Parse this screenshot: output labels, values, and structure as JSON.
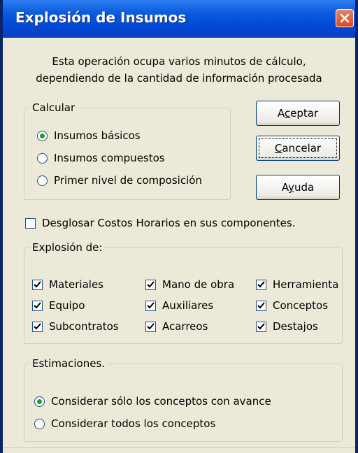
{
  "window": {
    "title": "Explosión de Insumos"
  },
  "intro": {
    "line1": "Esta operación ocupa varios minutos de cálculo,",
    "line2": "dependiendo de la cantidad de información procesada"
  },
  "calcular": {
    "label": "Calcular",
    "options": [
      {
        "label": "Insumos básicos",
        "checked": true
      },
      {
        "label": "Insumos compuestos",
        "checked": false
      },
      {
        "label": "Primer nivel de composición",
        "checked": false
      }
    ]
  },
  "buttons": {
    "aceptar_pre": "A",
    "aceptar_u": "c",
    "aceptar_post": "eptar",
    "cancelar_u": "C",
    "cancelar_post": "ancelar",
    "ayuda_pre": "A",
    "ayuda_u": "y",
    "ayuda_post": "uda"
  },
  "desglosar": {
    "label": "Desglosar Costos Horarios en sus componentes.",
    "checked": false
  },
  "explosion": {
    "label": "Explosión de:",
    "items": [
      {
        "label": "Materiales",
        "checked": true
      },
      {
        "label": "Mano de obra",
        "checked": true
      },
      {
        "label": "Herramienta",
        "checked": true
      },
      {
        "label": "Equipo",
        "checked": true
      },
      {
        "label": "Auxiliares",
        "checked": true
      },
      {
        "label": "Conceptos",
        "checked": true
      },
      {
        "label": "Subcontratos",
        "checked": true
      },
      {
        "label": "Acarreos",
        "checked": true
      },
      {
        "label": "Destajos",
        "checked": true
      }
    ]
  },
  "estimaciones": {
    "label": "Estimaciones.",
    "options": [
      {
        "label": "Considerar sólo los conceptos con avance",
        "checked": true
      },
      {
        "label": "Considerar todos los conceptos",
        "checked": false
      }
    ]
  },
  "colors": {
    "titlebar": "#0a5ae0",
    "close": "#d8491f",
    "dialog_bg": "#ece9d8",
    "check_mark": "#21a121"
  }
}
